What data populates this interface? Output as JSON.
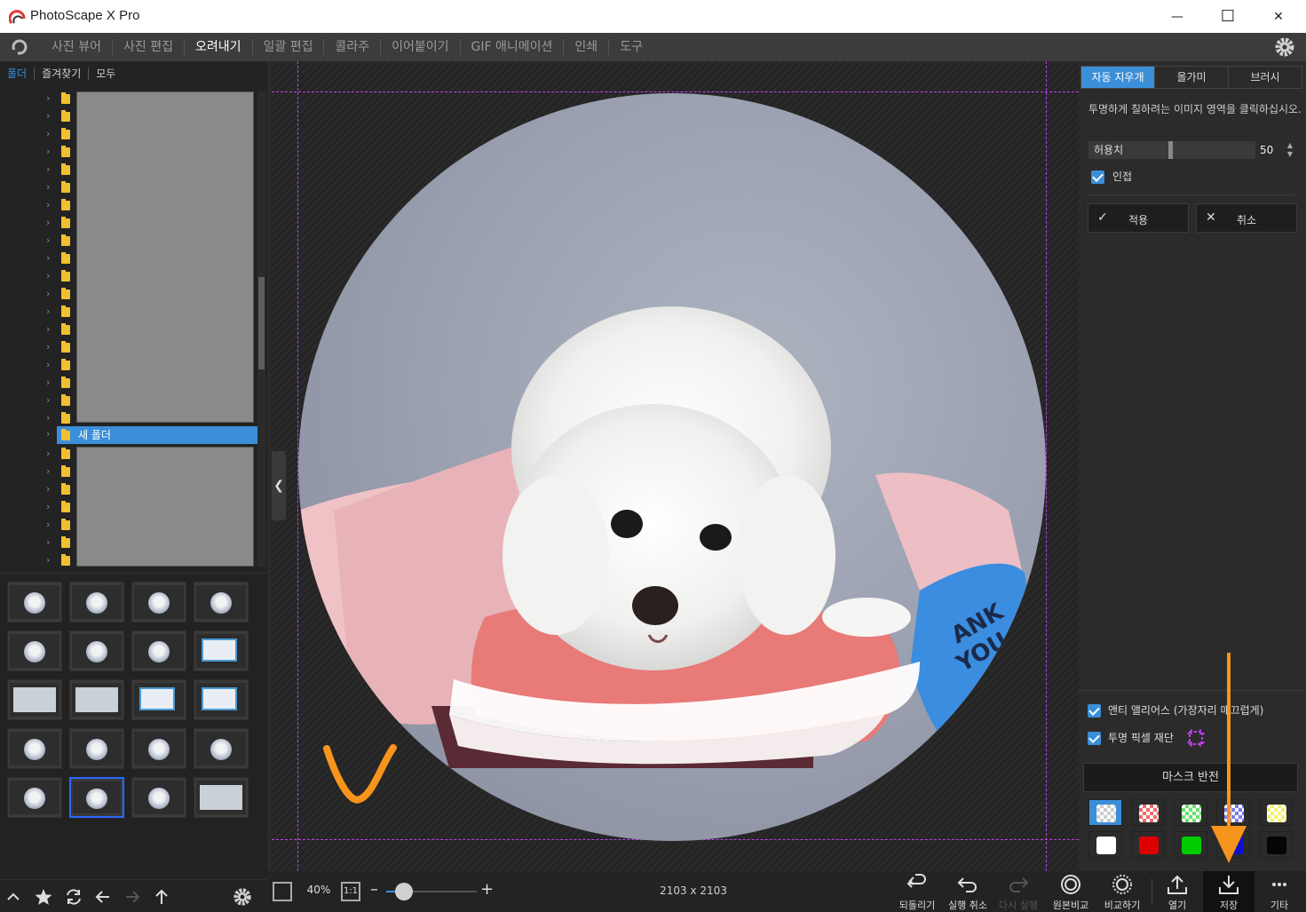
{
  "window": {
    "title": "PhotoScape X Pro",
    "minimize_glyph": "—",
    "maximize_glyph": "☐",
    "close_glyph": "✕"
  },
  "menu": {
    "items": [
      {
        "label": "사진 뷰어"
      },
      {
        "label": "사진 편집"
      },
      {
        "label": "오려내기",
        "active": true
      },
      {
        "label": "일괄 편집"
      },
      {
        "label": "콜라주"
      },
      {
        "label": "이어붙이기"
      },
      {
        "label": "GIF 애니메이션"
      },
      {
        "label": "인쇄"
      },
      {
        "label": "도구"
      }
    ]
  },
  "left_panel": {
    "tabs": [
      {
        "label": "폴더",
        "active": true
      },
      {
        "label": "즐겨찾기"
      },
      {
        "label": "모두"
      }
    ],
    "selected_folder": "새 폴더"
  },
  "right_panel": {
    "tabs": [
      {
        "label": "자동 지우개",
        "active": true
      },
      {
        "label": "올가미"
      },
      {
        "label": "브러시"
      }
    ],
    "help_text": "투명하게 칠하려는 이미지 영역을 클릭하십시오.",
    "tolerance": {
      "label": "허용치",
      "value": "50"
    },
    "adjacent": {
      "label": "인접",
      "checked": true
    },
    "apply_label": "적용",
    "cancel_label": "취소",
    "antialias": {
      "label": "앤티 앨리어스 (가장자리 매끄럽게)",
      "checked": true
    },
    "trim": {
      "label": "투명 픽셀 재단",
      "checked": true
    },
    "invert_mask_label": "마스크 반전",
    "swatches": [
      {
        "name": "transparent",
        "color": "#cccccc",
        "selected": true
      },
      {
        "name": "red-translucent",
        "color": "#f06a6a"
      },
      {
        "name": "green-translucent",
        "color": "#6ae06a"
      },
      {
        "name": "blue-translucent",
        "color": "#7a7af0"
      },
      {
        "name": "yellow-translucent",
        "color": "#f0f070"
      },
      {
        "name": "white",
        "color": "#ffffff"
      },
      {
        "name": "red",
        "color": "#dd0000"
      },
      {
        "name": "green",
        "color": "#00cc00"
      },
      {
        "name": "blue",
        "color": "#1010cc"
      },
      {
        "name": "black",
        "color": "#050505"
      }
    ]
  },
  "bottom_bar": {
    "zoom": "40%",
    "one_to_one": "1:1",
    "dimensions": "2103 x 2103",
    "buttons": [
      {
        "label": "되돌리기",
        "icon": "revert-icon"
      },
      {
        "label": "실행 취소",
        "icon": "undo-icon"
      },
      {
        "label": "다시 실행",
        "icon": "redo-icon",
        "disabled": true
      },
      {
        "label": "원본비교",
        "icon": "compare-original-icon"
      },
      {
        "label": "비교하기",
        "icon": "compare-icon"
      },
      {
        "label": "열기",
        "icon": "open-icon"
      },
      {
        "label": "저장",
        "icon": "save-icon"
      },
      {
        "label": "기타",
        "icon": "more-icon"
      }
    ]
  },
  "colors": {
    "accent": "#3b8fd9",
    "annotation": "#f7941d",
    "guide": "#c040f0"
  }
}
